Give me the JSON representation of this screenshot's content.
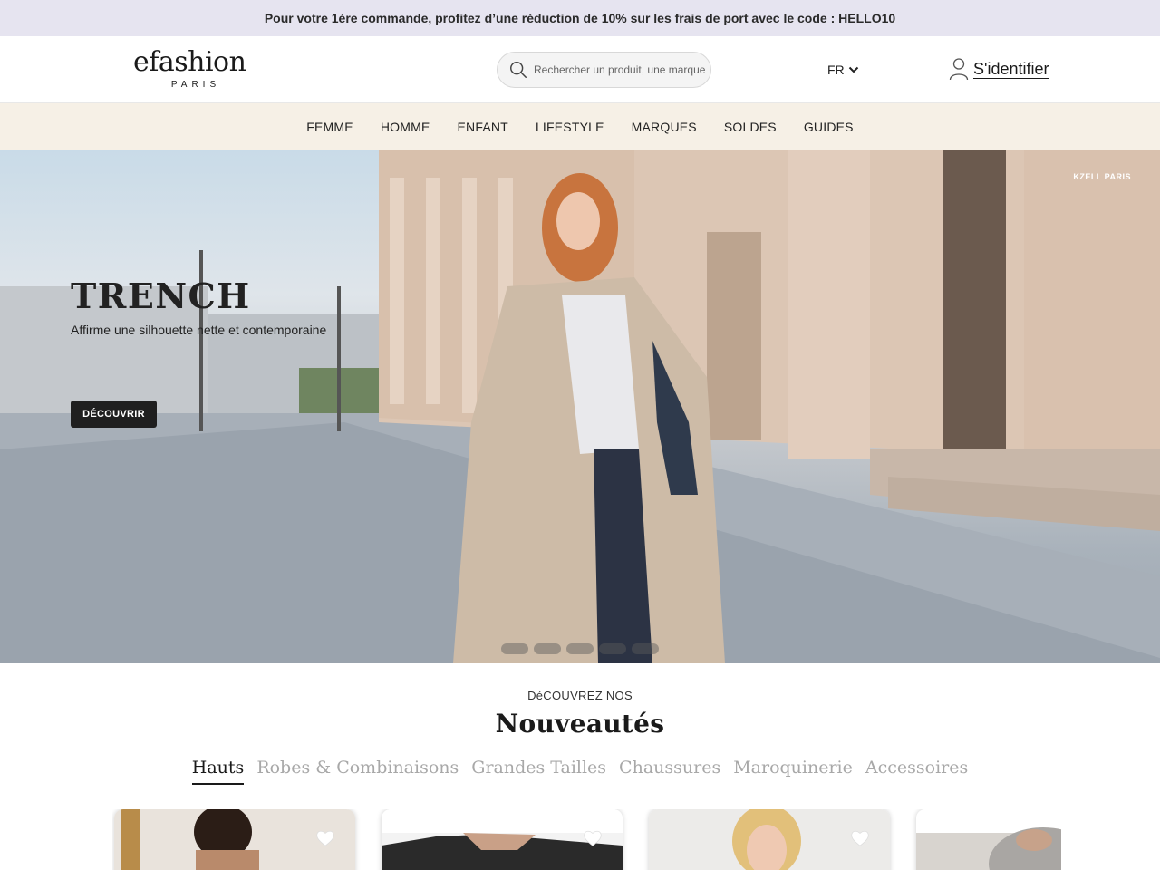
{
  "promo": {
    "text": "Pour votre 1ère commande, profitez d’une réduction de 10% sur les frais de port avec le code : HELLO10"
  },
  "header": {
    "logo": {
      "main": "efashion",
      "sub": "PARIS"
    },
    "search": {
      "placeholder": "Rechercher un produit, une marque",
      "icon": "search-icon"
    },
    "language": {
      "label": "FR",
      "icon": "chevron-down-icon"
    },
    "signin": {
      "label": "S'identifier",
      "icon": "user-icon"
    }
  },
  "nav": {
    "items": [
      {
        "label": "FEMME"
      },
      {
        "label": "HOMME"
      },
      {
        "label": "ENFANT"
      },
      {
        "label": "LIFESTYLE"
      },
      {
        "label": "MARQUES"
      },
      {
        "label": "SOLDES"
      },
      {
        "label": "GUIDES"
      }
    ]
  },
  "hero": {
    "brand": "KZELL PARIS",
    "title": "TRENCH",
    "subtitle": "Affirme une silhouette nette et contemporaine",
    "cta": "DÉCOUVRIR",
    "slide_count": 5
  },
  "new_arrivals": {
    "kicker": "DéCOUVREZ NOS",
    "title": "Nouveautés",
    "tabs": [
      {
        "label": "Hauts",
        "active": true
      },
      {
        "label": "Robes & Combinaisons",
        "active": false
      },
      {
        "label": "Grandes Tailles",
        "active": false
      },
      {
        "label": "Chaussures",
        "active": false
      },
      {
        "label": "Maroquinerie",
        "active": false
      },
      {
        "label": "Accessoires",
        "active": false
      }
    ],
    "products": [
      {
        "favorite_icon": "heart-icon"
      },
      {
        "favorite_icon": "heart-icon"
      },
      {
        "favorite_icon": "heart-icon"
      },
      {
        "favorite_icon": "heart-icon"
      }
    ]
  },
  "colors": {
    "promo_bg": "#e6e4f0",
    "nav_bg": "#f6f0e6",
    "cta_bg": "#1f1f1f",
    "text": "#1a1a1a",
    "tab_inactive": "#a8a8a8"
  }
}
